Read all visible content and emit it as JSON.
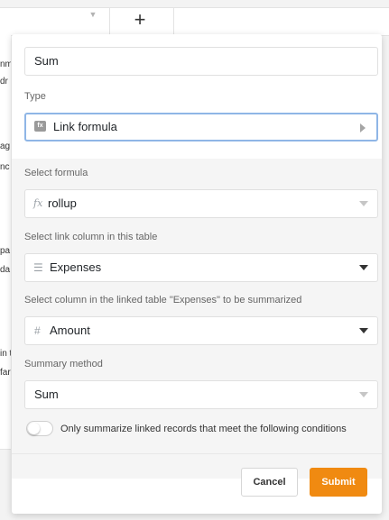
{
  "background": {
    "fragments": [
      "nm",
      "dr",
      "ag",
      "nc",
      "pa",
      "da",
      "in t",
      "far"
    ]
  },
  "dialog": {
    "name_value": "Sum",
    "type_label": "Type",
    "type_value": "Link formula",
    "type_icon": "formula-icon",
    "select_formula_label": "Select formula",
    "formula_value": "rollup",
    "formula_icon": "fx-icon",
    "link_column_label": "Select link column in this table",
    "link_column_value": "Expenses",
    "link_column_icon": "long-text-icon",
    "linked_column_label": "Select column in the linked table \"Expenses\" to be summarized",
    "linked_column_value": "Amount",
    "linked_column_icon": "number-icon",
    "summary_method_label": "Summary method",
    "summary_method_value": "Sum",
    "condition_toggle_label": "Only summarize linked records that meet the following conditions",
    "condition_toggle_on": false,
    "cancel_label": "Cancel",
    "submit_label": "Submit",
    "submit_color": "#f08a11"
  }
}
